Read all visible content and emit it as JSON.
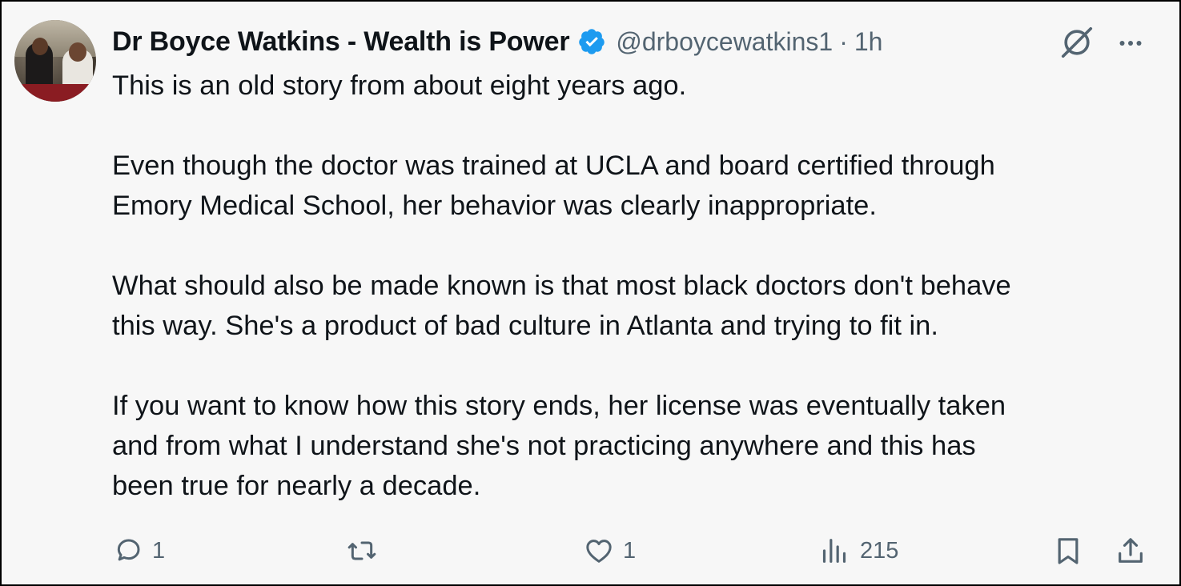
{
  "author": {
    "display_name": "Dr Boyce Watkins - Wealth is Power",
    "handle": "@drboycewatkins1",
    "separator": "·",
    "time": "1h"
  },
  "post": {
    "paragraphs": [
      "This is an old story from about eight years ago.",
      "Even though the doctor was trained at UCLA and board certified through\nEmory Medical School, her behavior was clearly inappropriate.",
      "What should also be made known is that most black doctors don't behave\nthis way. She's a product of bad culture in Atlanta and trying to fit in.",
      "If you want to know how this story ends, her license was eventually taken\nand from what I understand she's not practicing anywhere and this has\nbeen true for nearly a decade."
    ]
  },
  "actions": {
    "replies": "1",
    "reposts": "",
    "likes": "1",
    "views": "215"
  },
  "icons": {
    "verified": "verified-badge-icon",
    "grok": "grok-icon",
    "more": "more-dots-icon",
    "reply": "reply-icon",
    "repost": "repost-icon",
    "like": "heart-icon",
    "views": "views-chart-icon",
    "bookmark": "bookmark-icon",
    "share": "share-icon"
  },
  "colors": {
    "text": "#0f1419",
    "secondary": "#536471",
    "verified": "#1d9bf0",
    "background": "#f7f7f7"
  }
}
